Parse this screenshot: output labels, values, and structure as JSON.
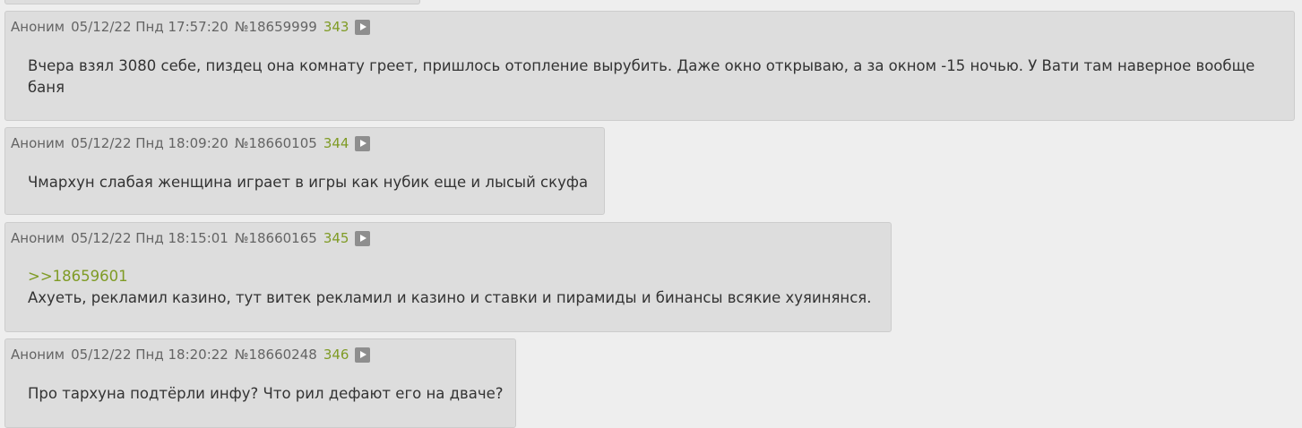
{
  "posts": [
    {
      "author": "Аноним",
      "date": "05/12/22 Пнд 17:57:20",
      "post_id": "№18659999",
      "number": "343",
      "reply_link": "",
      "text_lines": [
        "Вчера взял 3080 себе, пиздец она комнату греет, пришлось отопление вырубить. Даже окно открываю, а за окном -15 ночью. У Вати там наверное вообще",
        "баня"
      ]
    },
    {
      "author": "Аноним",
      "date": "05/12/22 Пнд 18:09:20",
      "post_id": "№18660105",
      "number": "344",
      "reply_link": "",
      "text_lines": [
        "Чмархун слабая женщина играет в игры как нубик еще и лысый скуфа"
      ]
    },
    {
      "author": "Аноним",
      "date": "05/12/22 Пнд 18:15:01",
      "post_id": "№18660165",
      "number": "345",
      "reply_link": ">>18659601",
      "text_lines": [
        "Ахуеть, рекламил казино, тут витек рекламил и казино и ставки и пирамиды и бинансы всякие хуяинянся."
      ]
    },
    {
      "author": "Аноним",
      "date": "05/12/22 Пнд 18:20:22",
      "post_id": "№18660248",
      "number": "346",
      "reply_link": "",
      "text_lines": [
        "Про тархуна подтёрли инфу? Что рил дефают его на дваче?"
      ]
    }
  ],
  "colors": {
    "page_background": "#eeeeee",
    "post_background": "#dddddd",
    "post_number": "#7f9b25",
    "reply_link": "#7f9b25",
    "header_text": "#646464",
    "body_text": "#333333",
    "reply_button": "#8e8e8e"
  },
  "icons": {
    "reply_button": "play-triangle-icon"
  }
}
